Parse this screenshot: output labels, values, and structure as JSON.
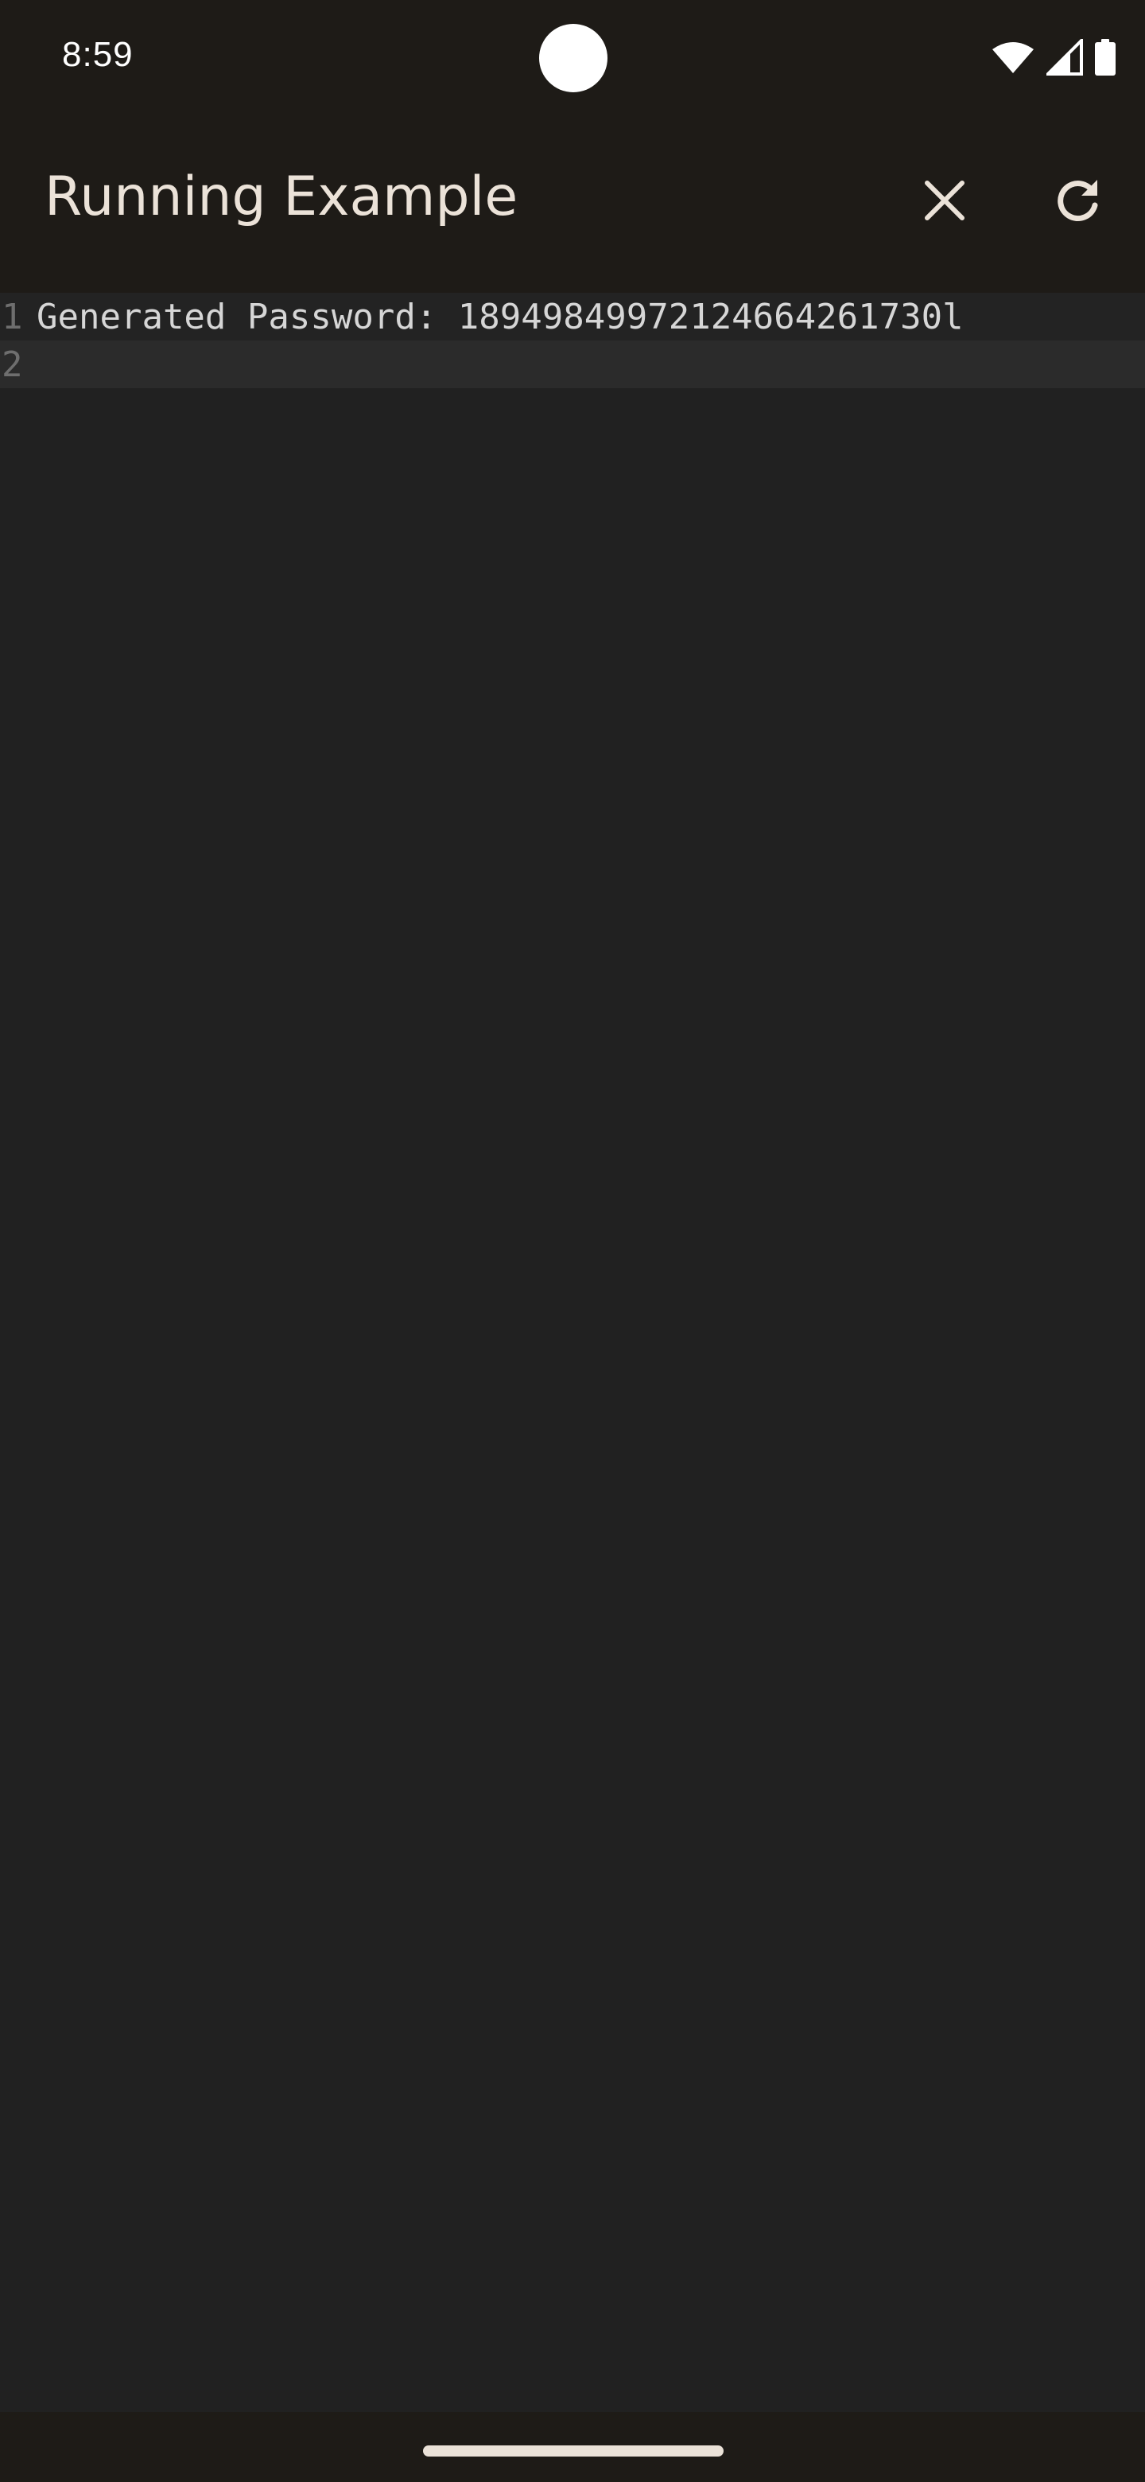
{
  "status_bar": {
    "time": "8:59",
    "icons": [
      "wifi-icon",
      "cellular-signal-icon",
      "battery-icon"
    ]
  },
  "app_bar": {
    "title": "Running Example",
    "actions": [
      {
        "name": "close-icon"
      },
      {
        "name": "refresh-icon"
      }
    ]
  },
  "editor": {
    "lines": [
      {
        "number": "1",
        "text": "Generated Password: 18949849972124664261730l"
      },
      {
        "number": "2",
        "text": ""
      }
    ]
  },
  "colors": {
    "app_bar_background": "#1e1b17",
    "editor_background": "#212121",
    "title_text": "#ebe2d8",
    "code_text": "#d6d6d6",
    "line_number_text": "#6e6e6e"
  }
}
